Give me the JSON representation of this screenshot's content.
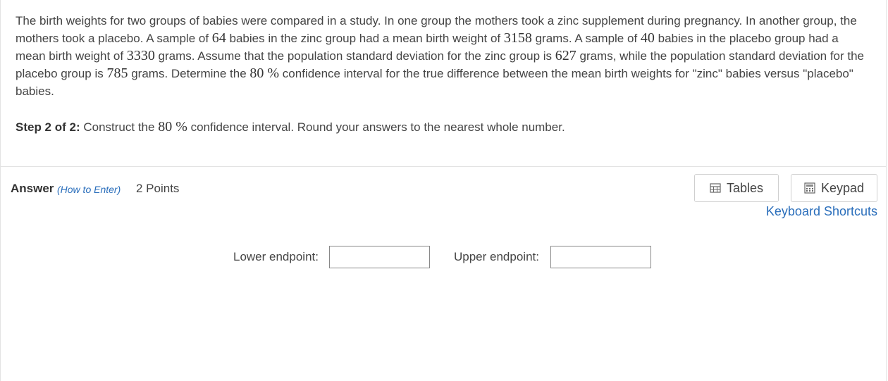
{
  "question": {
    "t1": "The birth weights for two groups of babies were compared in a study. In one group the mothers took a zinc supplement during pregnancy. In another group, the mothers took a placebo. A sample of ",
    "n1": "64",
    "t2": " babies in the zinc group had a mean birth weight of ",
    "m1": "3158",
    "t3": " grams. A sample of ",
    "n2": "40",
    "t4": " babies in the placebo group had a mean birth weight of ",
    "m2": "3330",
    "t5": " grams. Assume that the population standard deviation for the zinc group is ",
    "s1": "627",
    "t6": " grams, while the population standard deviation for the placebo group is ",
    "s2": "785",
    "t7": " grams. Determine the ",
    "conf": "80 %",
    "t8": " confidence interval for the true difference between the mean birth weights for \"zinc\" babies versus \"placebo\" babies."
  },
  "step": {
    "label": "Step 2 of 2:",
    "t1": " Construct the ",
    "conf": "80 %",
    "t2": " confidence interval. Round your answers to the nearest whole number."
  },
  "answer": {
    "label": "Answer",
    "how_to_enter": "(How to Enter)",
    "points": "2 Points"
  },
  "tools": {
    "tables": "Tables",
    "keypad": "Keypad",
    "shortcuts": "Keyboard Shortcuts"
  },
  "fields": {
    "lower_label": "Lower endpoint:",
    "upper_label": "Upper endpoint:",
    "lower_value": "",
    "upper_value": ""
  }
}
